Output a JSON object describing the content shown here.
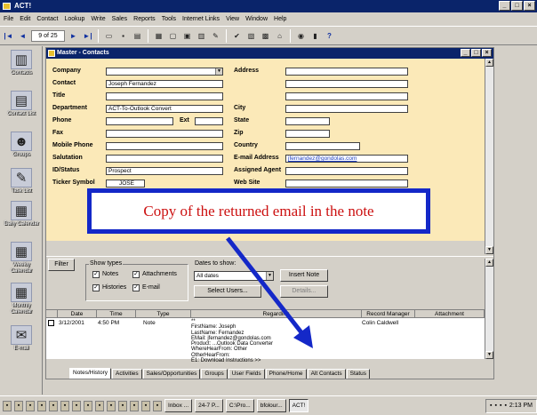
{
  "window": {
    "title": "ACT!"
  },
  "menu": [
    "File",
    "Edit",
    "Contact",
    "Lookup",
    "Write",
    "Sales",
    "Reports",
    "Tools",
    "Internet Links",
    "View",
    "Window",
    "Help"
  ],
  "toolbar": {
    "record_position": "9 of 25"
  },
  "sidebar": [
    {
      "label": "Contacts",
      "icon": "contacts-icon"
    },
    {
      "label": "Contact List",
      "icon": "contact-list-icon"
    },
    {
      "label": "Groups",
      "icon": "groups-icon"
    },
    {
      "label": "Task List",
      "icon": "task-list-icon"
    },
    {
      "label": "Daily Calendar",
      "icon": "daily-calendar-icon"
    },
    {
      "label": "Weekly Calendar",
      "icon": "weekly-calendar-icon"
    },
    {
      "label": "Monthly Calendar",
      "icon": "monthly-calendar-icon"
    },
    {
      "label": "E-mail",
      "icon": "email-icon"
    }
  ],
  "contact_window": {
    "title": "Master - Contacts"
  },
  "form": {
    "company": {
      "label": "Company",
      "value": ""
    },
    "contact": {
      "label": "Contact",
      "value": "Joseph Fernandez"
    },
    "title": {
      "label": "Title",
      "value": ""
    },
    "department": {
      "label": "Department",
      "value": "ACT-To-Outlook Convert"
    },
    "phone": {
      "label": "Phone",
      "value": ""
    },
    "ext": {
      "label": "Ext",
      "value": ""
    },
    "fax": {
      "label": "Fax",
      "value": ""
    },
    "mobile_phone": {
      "label": "Mobile Phone",
      "value": ""
    },
    "salutation": {
      "label": "Salutation",
      "value": ""
    },
    "id_status": {
      "label": "ID/Status",
      "value": "Prospect"
    },
    "ticker_symbol": {
      "label": "Ticker Symbol",
      "value": "JOSE"
    },
    "address": {
      "label": "Address",
      "value": ""
    },
    "city": {
      "label": "City",
      "value": ""
    },
    "state": {
      "label": "State",
      "value": ""
    },
    "zip": {
      "label": "Zip",
      "value": ""
    },
    "country": {
      "label": "Country",
      "value": ""
    },
    "email_address": {
      "label": "E-mail Address",
      "value": "jfernandez@gondolas.com"
    },
    "assigned_agent": {
      "label": "Assigned Agent",
      "value": ""
    },
    "web_site": {
      "label": "Web Site",
      "value": ""
    }
  },
  "callout": {
    "text": "Copy of the returned email in the note"
  },
  "notes_panel": {
    "filter_label": "Filter",
    "show_types_label": "Show types",
    "show_types": [
      {
        "label": "Notes",
        "checked": true
      },
      {
        "label": "Attachments",
        "checked": true
      },
      {
        "label": "Histories",
        "checked": true
      },
      {
        "label": "E-mail",
        "checked": true
      }
    ],
    "dates_label": "Dates to show:",
    "dates_value": "All dates",
    "select_users_button": "Select Users...",
    "insert_note_button": "Insert Note",
    "details_button": "Details...",
    "columns": [
      "Date",
      "Time",
      "Type",
      "Regarding",
      "Record Manager",
      "Attachment"
    ],
    "row": {
      "date": "3/12/2001",
      "time": "4:50 PM",
      "type": "Note",
      "regarding": [
        "**",
        "FirstName:    Joseph",
        "LastName:     Fernandez",
        "EMail:         jfernandez@gondolas.com",
        "Product:      ...Outlook Data Converter",
        "WhereHearFrom:   Other",
        "OtherHearFrom:",
        "E1:          Download Instructions >>"
      ],
      "record_manager": "Colin Caldwell",
      "attachment": ""
    }
  },
  "tabs": [
    "Notes/History",
    "Activities",
    "Sales/Opportunities",
    "Groups",
    "User Fields",
    "Phone/Home",
    "Alt Contacts",
    "Status"
  ],
  "taskbar": {
    "buttons": [
      "Inbox ...",
      "24-7 P...",
      "C:\\Pro...",
      "bfolour...",
      "ACT!"
    ],
    "clock": "2:13 PM"
  }
}
